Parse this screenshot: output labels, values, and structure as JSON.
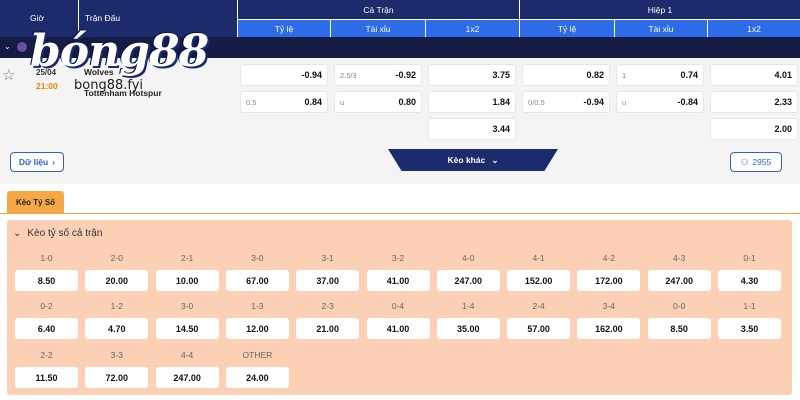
{
  "header": {
    "gio": "Giờ",
    "tran_dau": "Trận Đấu",
    "ca_tran": "Cả Trận",
    "hiep1": "Hiệp 1",
    "ca_tran_cols": [
      "Tỷ lệ",
      "Tài xỉu",
      "1x2"
    ],
    "hiep1_cols": [
      "Tỷ lệ",
      "Tài xỉu",
      "1x2"
    ]
  },
  "logo": {
    "main": "bóng88",
    "sub": "bong88.fyi"
  },
  "match": {
    "date": "25/04",
    "time": "21:00",
    "home": "Wolves",
    "away": "Tottenham Hotspur",
    "full": {
      "tyle": [
        {
          "h": "",
          "v": "-0.94"
        },
        {
          "h": "0.5",
          "v": "0.84"
        }
      ],
      "taixiu": [
        {
          "h": "2.5/3",
          "v": "-0.92"
        },
        {
          "h": "u",
          "v": "0.80"
        }
      ],
      "x12": [
        "3.75",
        "1.84",
        "3.44"
      ]
    },
    "half": {
      "tyle": [
        {
          "h": "",
          "v": "0.82"
        },
        {
          "h": "0/0.5",
          "v": "-0.94"
        }
      ],
      "taixiu": [
        {
          "h": "1",
          "v": "0.74"
        },
        {
          "h": "u",
          "v": "-0.84"
        }
      ],
      "x12": [
        "4.01",
        "2.33",
        "2.00"
      ]
    }
  },
  "buttons": {
    "du_lieu": "Dữ liệu",
    "keo_khac": "Kèo khác",
    "viewers": "2955"
  },
  "tab": {
    "label": "Kèo Tỷ Số"
  },
  "panel": {
    "title": "Kèo tỷ số cả trận",
    "rows": [
      [
        {
          "s": "1-0",
          "o": "8.50"
        },
        {
          "s": "2-0",
          "o": "20.00"
        },
        {
          "s": "2-1",
          "o": "10.00"
        },
        {
          "s": "3-0",
          "o": "67.00"
        },
        {
          "s": "3-1",
          "o": "37.00"
        },
        {
          "s": "3-2",
          "o": "41.00"
        },
        {
          "s": "4-0",
          "o": "247.00"
        },
        {
          "s": "4-1",
          "o": "152.00"
        },
        {
          "s": "4-2",
          "o": "172.00"
        },
        {
          "s": "4-3",
          "o": "247.00"
        },
        {
          "s": "0-1",
          "o": "4.30"
        }
      ],
      [
        {
          "s": "0-2",
          "o": "6.40"
        },
        {
          "s": "1-2",
          "o": "4.70"
        },
        {
          "s": "3-0",
          "o": "14.50"
        },
        {
          "s": "1-3",
          "o": "12.00"
        },
        {
          "s": "2-3",
          "o": "21.00"
        },
        {
          "s": "0-4",
          "o": "41.00"
        },
        {
          "s": "1-4",
          "o": "35.00"
        },
        {
          "s": "2-4",
          "o": "57.00"
        },
        {
          "s": "3-4",
          "o": "162.00"
        },
        {
          "s": "0-0",
          "o": "8.50"
        },
        {
          "s": "1-1",
          "o": "3.50"
        }
      ],
      [
        {
          "s": "2-2",
          "o": "11.50"
        },
        {
          "s": "3-3",
          "o": "72.00"
        },
        {
          "s": "4-4",
          "o": "247.00"
        },
        {
          "s": "OTHER",
          "o": "24.00"
        }
      ]
    ]
  }
}
